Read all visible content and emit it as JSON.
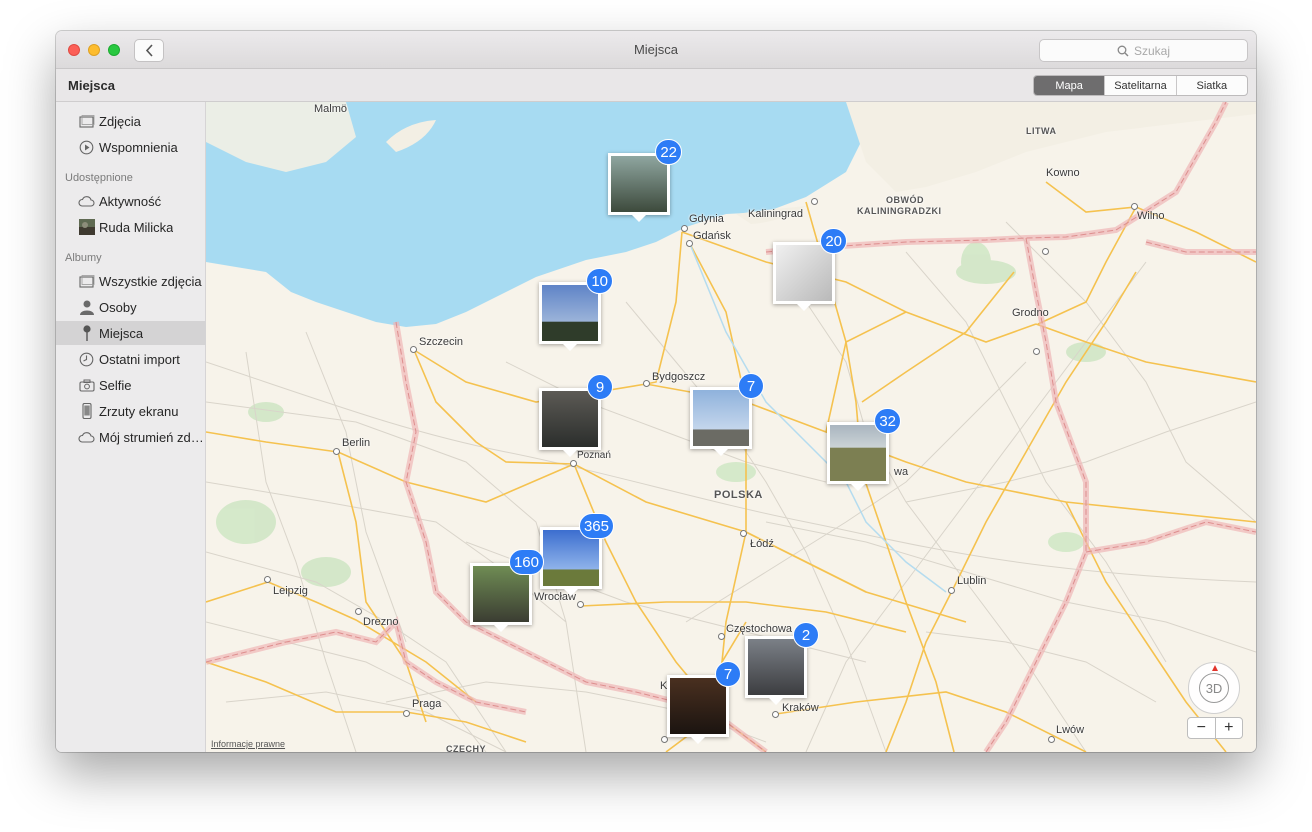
{
  "window": {
    "title": "Miejsca",
    "search_placeholder": "Szukaj"
  },
  "toolbar": {
    "section_title": "Miejsca",
    "view_modes": [
      {
        "label": "Mapa",
        "active": true
      },
      {
        "label": "Satelitarna",
        "active": false
      },
      {
        "label": "Siatka",
        "active": false
      }
    ]
  },
  "sidebar": {
    "library": [
      {
        "label": "Zdjęcia",
        "icon": "photos-icon"
      },
      {
        "label": "Wspomnienia",
        "icon": "memories-icon"
      }
    ],
    "shared_header": "Udostępnione",
    "shared": [
      {
        "label": "Aktywność",
        "icon": "cloud-icon"
      },
      {
        "label": "Ruda Milicka",
        "icon": "album-thumbnail-icon"
      }
    ],
    "albums_header": "Albumy",
    "albums": [
      {
        "label": "Wszystkie zdjęcia",
        "icon": "all-photos-icon"
      },
      {
        "label": "Osoby",
        "icon": "person-icon"
      },
      {
        "label": "Miejsca",
        "icon": "pin-icon",
        "selected": true
      },
      {
        "label": "Ostatni import",
        "icon": "clock-icon"
      },
      {
        "label": "Selfie",
        "icon": "camera-icon"
      },
      {
        "label": "Zrzuty ekranu",
        "icon": "phone-icon"
      },
      {
        "label": "Mój strumień zdjęć",
        "icon": "cloud-icon"
      }
    ]
  },
  "map": {
    "legal_link": "Informacje prawne",
    "compass_label": "3D",
    "zoom_out": "−",
    "zoom_in": "+",
    "cities": {
      "malmo": "Malmö",
      "gdynia": "Gdynia",
      "gdansk": "Gdańsk",
      "kaliningrad": "Kaliningrad",
      "obwod1": "OBWÓD",
      "obwod2": "KALININGRADZKI",
      "litwa": "LITWA",
      "kowno": "Kowno",
      "wilno": "Wilno",
      "grodno": "Grodno",
      "szczecin": "Szczecin",
      "bydgoszcz": "Bydgoszcz",
      "berlin": "Berlin",
      "poznan": "Poznań",
      "polska": "POLSKA",
      "lodz": "Łódź",
      "wa": "wa",
      "leipzig": "Leipzig",
      "wroclaw": "Wrocław",
      "drezno": "Drezno",
      "lublin": "Lublin",
      "czestochowa": "Częstochowa",
      "krakow": "Kraków",
      "praga": "Praga",
      "czechy": "CZECHY",
      "lwow": "Lwów",
      "k": "K"
    },
    "pins": [
      {
        "count": "22",
        "colors": [
          "#8fa6a0",
          "#3d4a3c"
        ]
      },
      {
        "count": "20",
        "colors": [
          "#e7e7e7",
          "#b9b9b9"
        ]
      },
      {
        "count": "10",
        "colors": [
          "#5f84c7",
          "#2f3c2a"
        ]
      },
      {
        "count": "9",
        "colors": [
          "#5c5a55",
          "#2b2e2c"
        ]
      },
      {
        "count": "7",
        "colors": [
          "#8fb2dc",
          "#6b6b64"
        ]
      },
      {
        "count": "32",
        "colors": [
          "#a9b5bf",
          "#7c7f52"
        ]
      },
      {
        "count": "365",
        "colors": [
          "#3c6ecf",
          "#6b7a3b"
        ]
      },
      {
        "count": "160",
        "colors": [
          "#6f8c54",
          "#3b3d32"
        ]
      },
      {
        "count": "2",
        "colors": [
          "#7b8087",
          "#3c3d40"
        ]
      },
      {
        "count": "7",
        "colors": [
          "#4a3020",
          "#1b1410"
        ]
      }
    ]
  }
}
